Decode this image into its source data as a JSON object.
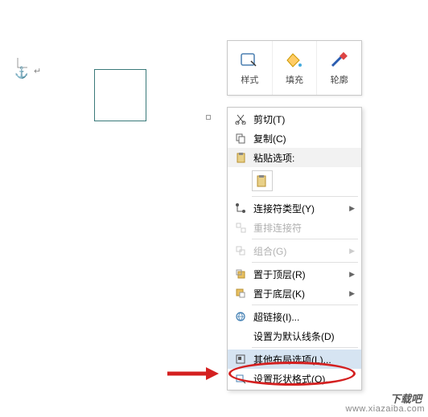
{
  "toolbar": {
    "style": "样式",
    "fill": "填充",
    "outline": "轮廓"
  },
  "menu": {
    "cut": "剪切(T)",
    "copy": "复制(C)",
    "paste_header": "粘贴选项:",
    "connector_type": "连接符类型(Y)",
    "rearrange_connector": "重排连接符",
    "group": "组合(G)",
    "bring_front": "置于顶层(R)",
    "send_back": "置于底层(K)",
    "hyperlink": "超链接(I)...",
    "set_default_line": "设置为默认线条(D)",
    "more_layout": "其他布局选项(L)...",
    "format_shape": "设置形状格式(O)..."
  },
  "watermark": "www.xiazaiba.com",
  "watermark_brand": "下载吧"
}
